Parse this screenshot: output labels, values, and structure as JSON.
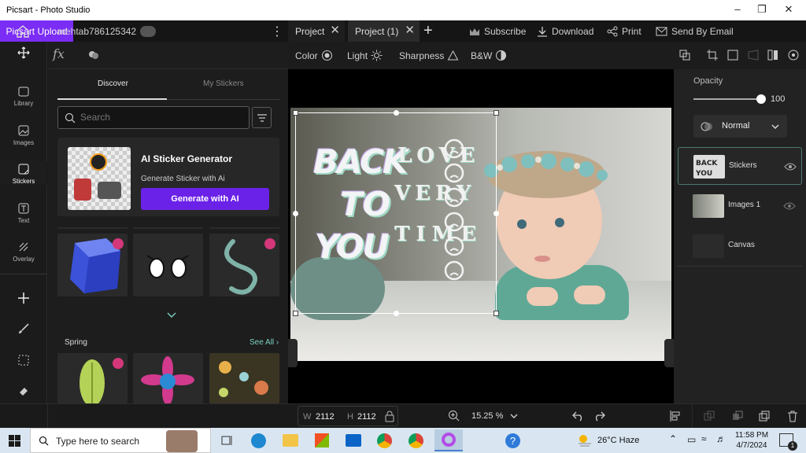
{
  "window": {
    "title": "Picsart - Photo Studio"
  },
  "tabs": [
    {
      "label": "Project"
    },
    {
      "label": "Project (1)"
    }
  ],
  "header_actions": {
    "subscribe": "Subscribe",
    "download": "Download",
    "print": "Print",
    "email": "Send By Email",
    "upload": "Picsart Upload"
  },
  "rail": {
    "items": [
      {
        "label": "Library"
      },
      {
        "label": "Images"
      },
      {
        "label": "Stickers"
      },
      {
        "label": "Text"
      },
      {
        "label": "Overlay"
      }
    ]
  },
  "user": {
    "name": "mehtab786125342",
    "badge": ""
  },
  "panel": {
    "tab_discover": "Discover",
    "tab_my": "My Stickers",
    "search_placeholder": "Search",
    "ai_title": "AI Sticker Generator",
    "ai_sub": "Generate Sticker with Ai",
    "ai_button": "Generate with AI",
    "section": "Spring",
    "see_all": "See All"
  },
  "canvas_tools": {
    "color": "Color",
    "light": "Light",
    "sharpness": "Sharpness",
    "bw": "B&W"
  },
  "sticker_text": {
    "line1": "BACK",
    "line2": "TO",
    "line3": "YOU",
    "script1": "LOVE",
    "script2": "VERY",
    "script3": "TIME"
  },
  "right": {
    "opacity_label": "Opacity",
    "opacity_value": "100",
    "opacity_level": 1.0,
    "blend": "Normal",
    "layers": [
      {
        "name": "Stickers"
      },
      {
        "name": "Images 1"
      },
      {
        "name": "Canvas"
      }
    ]
  },
  "bottom": {
    "w_label": "W",
    "w_value": "2112",
    "h_label": "H",
    "h_value": "2112",
    "zoom": "15.25 %"
  },
  "taskbar": {
    "search_placeholder": "Type here to search",
    "weather": "26°C  Haze",
    "time": "11:58 PM",
    "date": "4/7/2024",
    "notif_count": "1"
  },
  "colors": {
    "accent": "#7b2cf5",
    "panel": "#1d1d1d",
    "canvas_bg": "#000000"
  }
}
